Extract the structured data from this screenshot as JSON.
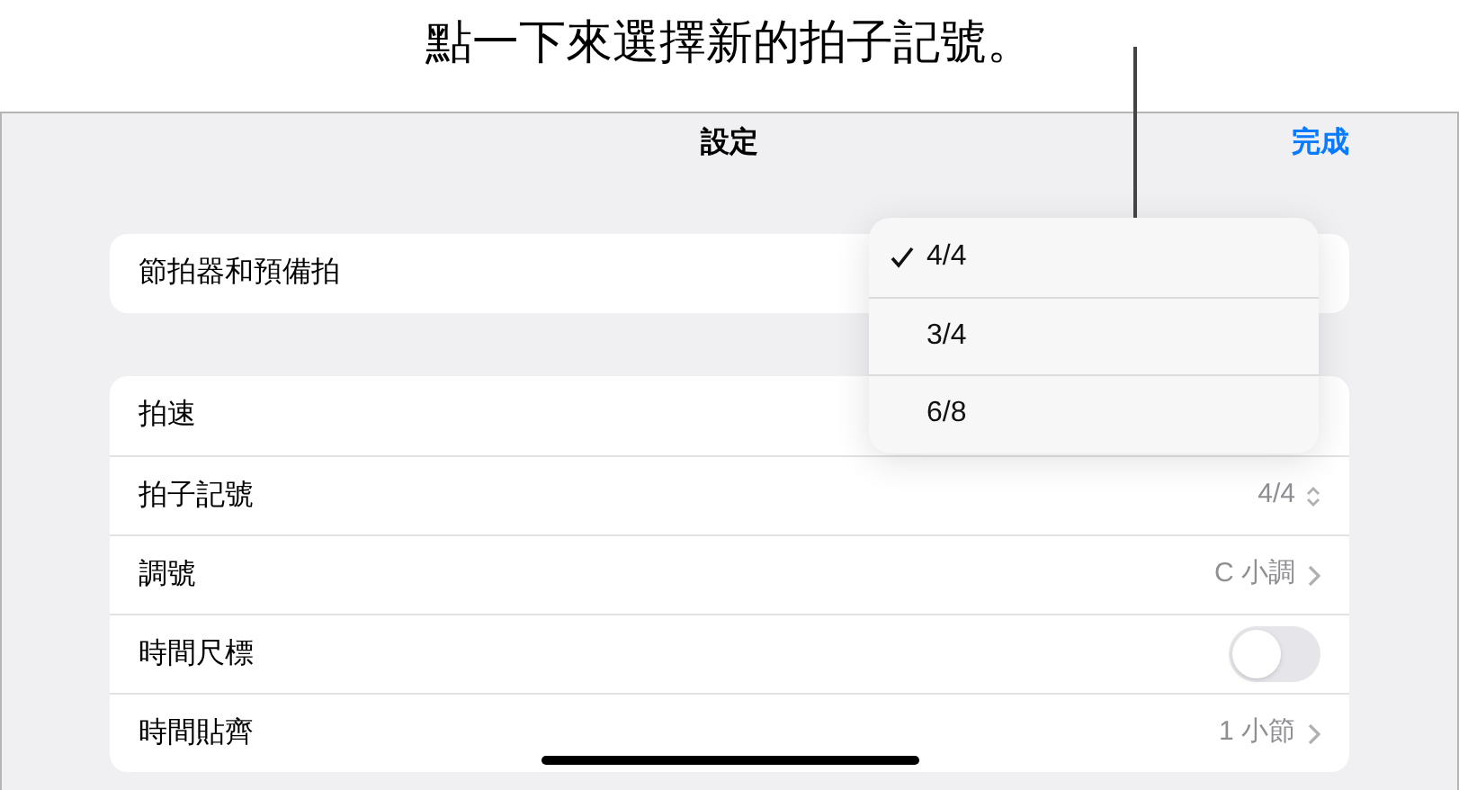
{
  "callout": {
    "text": "點一下來選擇新的拍子記號。"
  },
  "header": {
    "title": "設定",
    "done": "完成"
  },
  "groups": [
    {
      "rows": [
        {
          "kind": "plain",
          "label": "節拍器和預備拍"
        }
      ]
    },
    {
      "rows": [
        {
          "kind": "plain",
          "label": "拍速"
        },
        {
          "kind": "stepper",
          "label": "拍子記號",
          "value": "4/4"
        },
        {
          "kind": "link",
          "label": "調號",
          "value": "C 小調"
        },
        {
          "kind": "toggle",
          "label": "時間尺標",
          "on": false
        },
        {
          "kind": "link",
          "label": "時間貼齊",
          "value": "1 小節"
        }
      ]
    }
  ],
  "popup": {
    "items": [
      {
        "label": "4/4",
        "selected": true
      },
      {
        "label": "3/4",
        "selected": false
      },
      {
        "label": "6/8",
        "selected": false
      }
    ]
  }
}
